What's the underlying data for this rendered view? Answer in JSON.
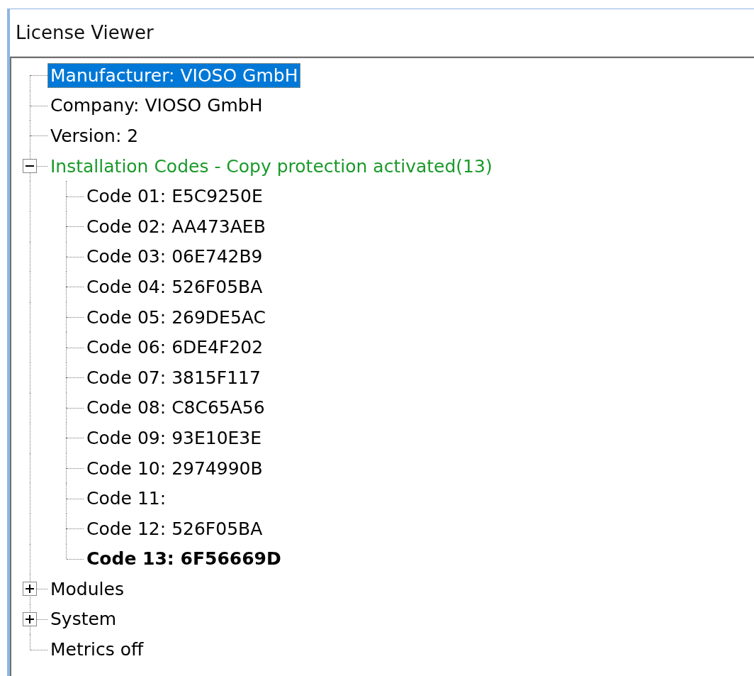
{
  "window": {
    "title": "License Viewer"
  },
  "tree": [
    {
      "text": "Manufacturer: VIOSO GmbH",
      "selected": true
    },
    {
      "text": "Company: VIOSO GmbH",
      "selected": false,
      "color": "#000000"
    },
    {
      "text": "Version: 2",
      "selected": false,
      "color": "#000000"
    },
    {
      "text": "Installation Codes - Copy protection activated(13)",
      "selected": false,
      "color": "#1a9a2a",
      "expanded": true,
      "children": [
        {
          "text": "Code 01: E5C9250E",
          "bold": false
        },
        {
          "text": "Code 02: AA473AEB",
          "bold": false
        },
        {
          "text": "Code 03: 06E742B9",
          "bold": false
        },
        {
          "text": "Code 04: 526F05BA",
          "bold": false
        },
        {
          "text": "Code 05: 269DE5AC",
          "bold": false
        },
        {
          "text": "Code 06: 6DE4F202",
          "bold": false
        },
        {
          "text": "Code 07: 3815F117",
          "bold": false
        },
        {
          "text": "Code 08: C8C65A56",
          "bold": false
        },
        {
          "text": "Code 09: 93E10E3E",
          "bold": false
        },
        {
          "text": "Code 10: 2974990B",
          "bold": false
        },
        {
          "text": "Code 11:",
          "bold": false
        },
        {
          "text": "Code 12: 526F05BA",
          "bold": false
        },
        {
          "text": "Code 13: 6F56669D",
          "bold": true
        }
      ]
    },
    {
      "text": "Modules",
      "selected": false,
      "color": "#000000",
      "expanded": false
    },
    {
      "text": "System",
      "selected": false,
      "color": "#000000",
      "expanded": false
    },
    {
      "text": "Metrics off",
      "selected": false,
      "color": "#000000"
    }
  ]
}
